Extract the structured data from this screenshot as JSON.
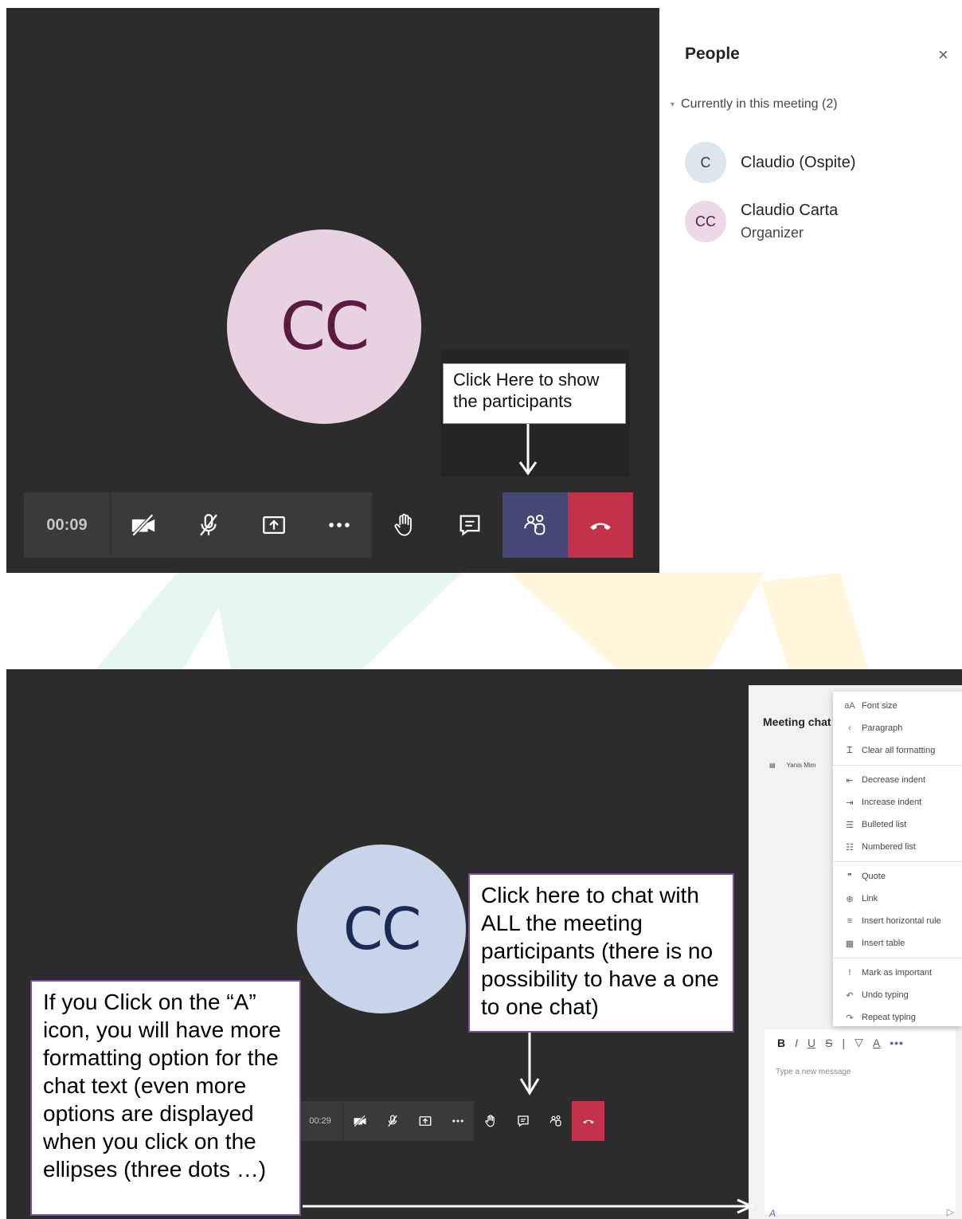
{
  "top": {
    "timer": "00:09",
    "avatar_initials": "CC",
    "callout": "Click Here to show the participants",
    "people_panel": {
      "title": "People",
      "close": "×",
      "section": "Currently in this meeting (2)",
      "participants": [
        {
          "initials": "C",
          "name": "Claudio (Ospite)",
          "role": ""
        },
        {
          "initials": "CC",
          "name": "Claudio Carta",
          "role": "Organizer"
        }
      ]
    }
  },
  "bottom": {
    "timer": "00:29",
    "avatar_initials": "CC",
    "callout_chat": "Click here to chat with ALL the meeting participants (there is no possibility to have a one to one chat)",
    "callout_format": "If you Click on the “A” icon, you will have more formatting option for the chat text (even more options are displayed when you click on the ellipses (three dots …)",
    "chat_panel": {
      "title": "Meeting chat",
      "item": "Yanis Mim",
      "format_bar": [
        "B",
        "I",
        "U",
        "S",
        "|",
        "▽",
        "A",
        "•••"
      ],
      "placeholder": "Type a new message",
      "send": "▷",
      "a_icon": "A"
    },
    "format_menu": [
      [
        {
          "icon": "aA",
          "label": "Font size"
        },
        {
          "icon": "‹",
          "label": "Paragraph"
        },
        {
          "icon": "Ꮖ",
          "label": "Clear all formatting"
        }
      ],
      [
        {
          "icon": "⇤",
          "label": "Decrease indent"
        },
        {
          "icon": "⇥",
          "label": "Increase indent"
        },
        {
          "icon": "☰",
          "label": "Bulleted list"
        },
        {
          "icon": "☷",
          "label": "Numbered list"
        }
      ],
      [
        {
          "icon": "❞",
          "label": "Quote"
        },
        {
          "icon": "⊕",
          "label": "Link"
        },
        {
          "icon": "≡",
          "label": "Insert horizontal rule"
        },
        {
          "icon": "▦",
          "label": "Insert table"
        }
      ],
      [
        {
          "icon": "!",
          "label": "Mark as important"
        },
        {
          "icon": "↶",
          "label": "Undo typing"
        },
        {
          "icon": "↷",
          "label": "Repeat typing"
        }
      ]
    ]
  },
  "colors": {
    "stage_bg": "#2d2c2c",
    "toolbar_bg": "#3b3a39",
    "people_active": "#464775",
    "hangup": "#c4314b",
    "callout_border": "#7a4f9e"
  }
}
